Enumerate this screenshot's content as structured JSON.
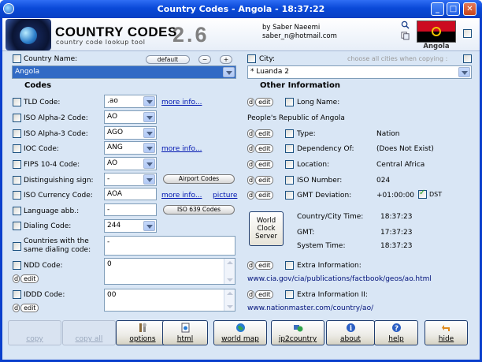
{
  "window": {
    "title": "Country Codes - Angola - 18:37:22"
  },
  "header": {
    "brand": "COUNTRY CODES",
    "tagline": "country code lookup tool",
    "version": "2.6",
    "author_line1": "by Saber Naeemi",
    "author_line2": "saber_n@hotmail.com",
    "flag_country": "Angola",
    "colors": {
      "flag_red": "#cc0a20",
      "flag_black": "#000000",
      "flag_emblem": "#f2c500"
    }
  },
  "country": {
    "label": "Country Name:",
    "default_btn": "default",
    "minus_btn": "−",
    "plus_btn": "+",
    "value": "Angola"
  },
  "city": {
    "label": "City:",
    "choose_hint": "choose all cities when copying :",
    "value": "* Luanda  2"
  },
  "codes": {
    "title": "Codes",
    "tld": {
      "label": "TLD Code:",
      "value": ".ao",
      "link": "more info..."
    },
    "iso2": {
      "label": "ISO Alpha-2 Code:",
      "value": "AO"
    },
    "iso3": {
      "label": "ISO Alpha-3 Code:",
      "value": "AGO"
    },
    "ioc": {
      "label": "IOC Code:",
      "value": "ANG",
      "link": "more info..."
    },
    "fips": {
      "label": "FIPS 10-4 Code:",
      "value": "AO"
    },
    "dist": {
      "label": "Distinguishing sign:",
      "value": "-",
      "btn": "Airport Codes"
    },
    "currency": {
      "label": "ISO Currency Code:",
      "value": "AOA",
      "link": "more info...",
      "link2": "picture"
    },
    "lang": {
      "label": "Language abb.:",
      "value": "-",
      "btn": "ISO 639 Codes"
    },
    "dialing": {
      "label": "Dialing Code:",
      "value": "244"
    },
    "same_dialing": {
      "label1": "Countries with the",
      "label2": "same dialing code:",
      "value": "-"
    },
    "ndd": {
      "label": "NDD Code:",
      "value": "0"
    },
    "iddd": {
      "label": "IDDD Code:",
      "value": "00"
    },
    "d": "d",
    "edit": "edit"
  },
  "other": {
    "title": "Other Information",
    "long_name": {
      "label": "Long Name:",
      "value": "People's Republic of Angola"
    },
    "type": {
      "label": "Type:",
      "value": "Nation"
    },
    "dependency": {
      "label": "Dependency Of:",
      "value": "(Does Not Exist)"
    },
    "location": {
      "label": "Location:",
      "value": "Central Africa"
    },
    "iso_number": {
      "label": "ISO Number:",
      "value": "024"
    },
    "gmt_dev": {
      "label": "GMT Deviation:",
      "value": "+01:00:00",
      "dst": "DST"
    },
    "world_clock": {
      "line1": "World",
      "line2": "Clock",
      "line3": "Server"
    },
    "city_time": {
      "label": "Country/City Time:",
      "value": "18:37:23"
    },
    "gmt": {
      "label": "GMT:",
      "value": "17:37:23"
    },
    "system_time": {
      "label": "System Time:",
      "value": "18:37:23"
    },
    "extra": {
      "label": "Extra Information:",
      "value": "www.cia.gov/cia/publications/factbook/geos/ao.html"
    },
    "extra2": {
      "label": "Extra Information II:",
      "value": "www.nationmaster.com/country/ao/"
    }
  },
  "toolbar": {
    "copy": "copy",
    "copy_all": "copy all",
    "options": "options",
    "html": "html",
    "world_map": "world map",
    "ip2country": "ip2country",
    "about": "about",
    "help": "help",
    "hide": "hide"
  }
}
